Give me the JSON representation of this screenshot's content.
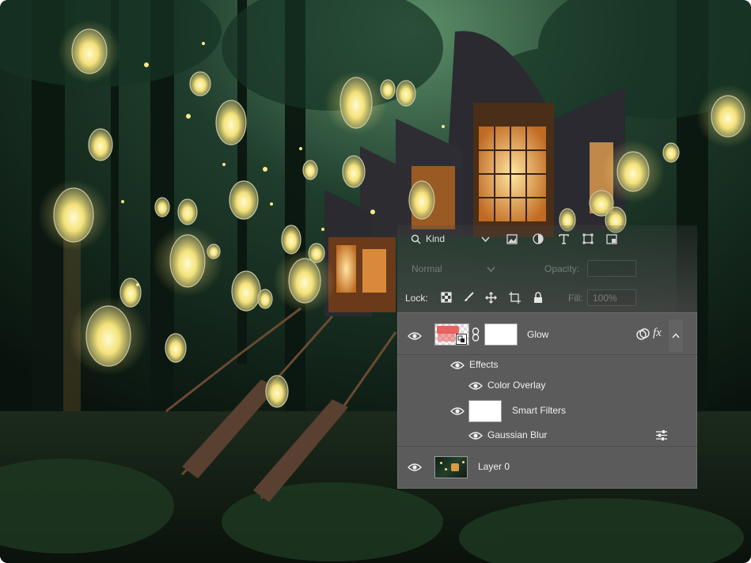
{
  "panel": {
    "filter": {
      "label": "Kind"
    },
    "blend": {
      "mode": "Normal",
      "opacity_label": "Opacity:"
    },
    "lock": {
      "label": "Lock:",
      "fill_label": "Fill:",
      "fill_value": "100%"
    },
    "layers": [
      {
        "name": "Glow",
        "visible": true,
        "has_fx": true,
        "expanded": true
      },
      {
        "name": "Effects",
        "visible": true
      },
      {
        "name": "Color Overlay",
        "visible": true
      },
      {
        "name": "Smart Filters",
        "visible": true
      },
      {
        "name": "Gaussian Blur",
        "visible": true
      },
      {
        "name": "Layer 0",
        "visible": true
      }
    ],
    "fx_label": "fx"
  },
  "colors": {
    "panel_bg": "#5b5b5b",
    "panel_text": "#e6e6e6",
    "lantern_glow": "#f6e27a",
    "house_glow": "#f2a64a"
  },
  "icons": [
    "search-icon",
    "chevron-down-icon",
    "image-filter-icon",
    "adjustment-filter-icon",
    "type-filter-icon",
    "shape-filter-icon",
    "smart-object-filter-icon",
    "lock-pixels-icon",
    "lock-brush-icon",
    "lock-move-icon",
    "lock-artboard-icon",
    "lock-all-icon",
    "eye-icon",
    "smart-object-badge-icon",
    "link-icon",
    "blend-options-icon",
    "fx-icon",
    "chevron-up-icon",
    "filter-options-icon"
  ]
}
